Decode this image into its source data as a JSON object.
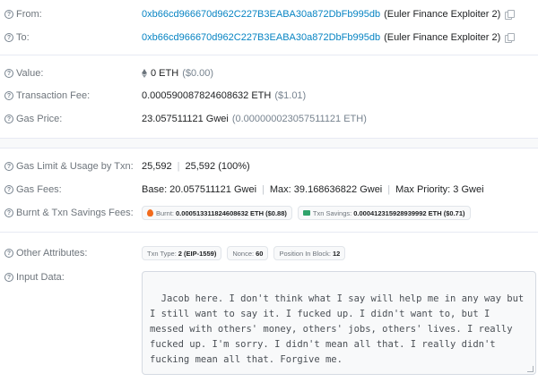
{
  "from": {
    "label": "From:",
    "address": "0xb66cd966670d962C227B3EABA30a872DbFb995db",
    "name": "(Euler Finance Exploiter 2)"
  },
  "to": {
    "label": "To:",
    "address": "0xb66cd966670d962C227B3EABA30a872DbFb995db",
    "name": "(Euler Finance Exploiter 2)"
  },
  "value": {
    "label": "Value:",
    "amount": "0 ETH",
    "usd": "($0.00)"
  },
  "fee": {
    "label": "Transaction Fee:",
    "amount": "0.000590087824608632 ETH",
    "usd": "($1.01)"
  },
  "gas_price": {
    "label": "Gas Price:",
    "amount": "23.057511121 Gwei",
    "eth": "(0.000000023057511121 ETH)"
  },
  "gas_limit": {
    "label": "Gas Limit & Usage by Txn:",
    "limit": "25,592",
    "usage": "25,592 (100%)"
  },
  "gas_fees": {
    "label": "Gas Fees:",
    "base": "Base: 20.057511121 Gwei",
    "max": "Max: 39.168636822 Gwei",
    "max_priority": "Max Priority: 3 Gwei"
  },
  "burnt": {
    "label": "Burnt & Txn Savings Fees:",
    "burnt_key": "Burnt:",
    "burnt_value": "0.000513311824608632 ETH ($0.88)",
    "savings_key": "Txn Savings:",
    "savings_value": "0.000412315928939992 ETH ($0.71)"
  },
  "other": {
    "label": "Other Attributes:",
    "txn_type_key": "Txn Type:",
    "txn_type_value": "2 (EIP-1559)",
    "nonce_key": "Nonce:",
    "nonce_value": "60",
    "position_key": "Position In Block:",
    "position_value": "12"
  },
  "input": {
    "label": "Input Data:",
    "text": "Jacob here. I don't think what I say will help me in any way but I still want to say it. I fucked up. I didn't want to, but I messed with others' money, others' jobs, others' lives. I really fucked up. I'm sorry. I didn't mean all that. I really didn't fucking mean all that. Forgive me."
  },
  "icons": {
    "help": "question-circle-icon",
    "copy": "copy-icon",
    "eth": "ethereum-icon",
    "fire": "fire-icon",
    "savings": "cash-icon"
  },
  "colors": {
    "link": "#0784c3",
    "label": "#6e757c",
    "band": "#f8f9fa"
  }
}
